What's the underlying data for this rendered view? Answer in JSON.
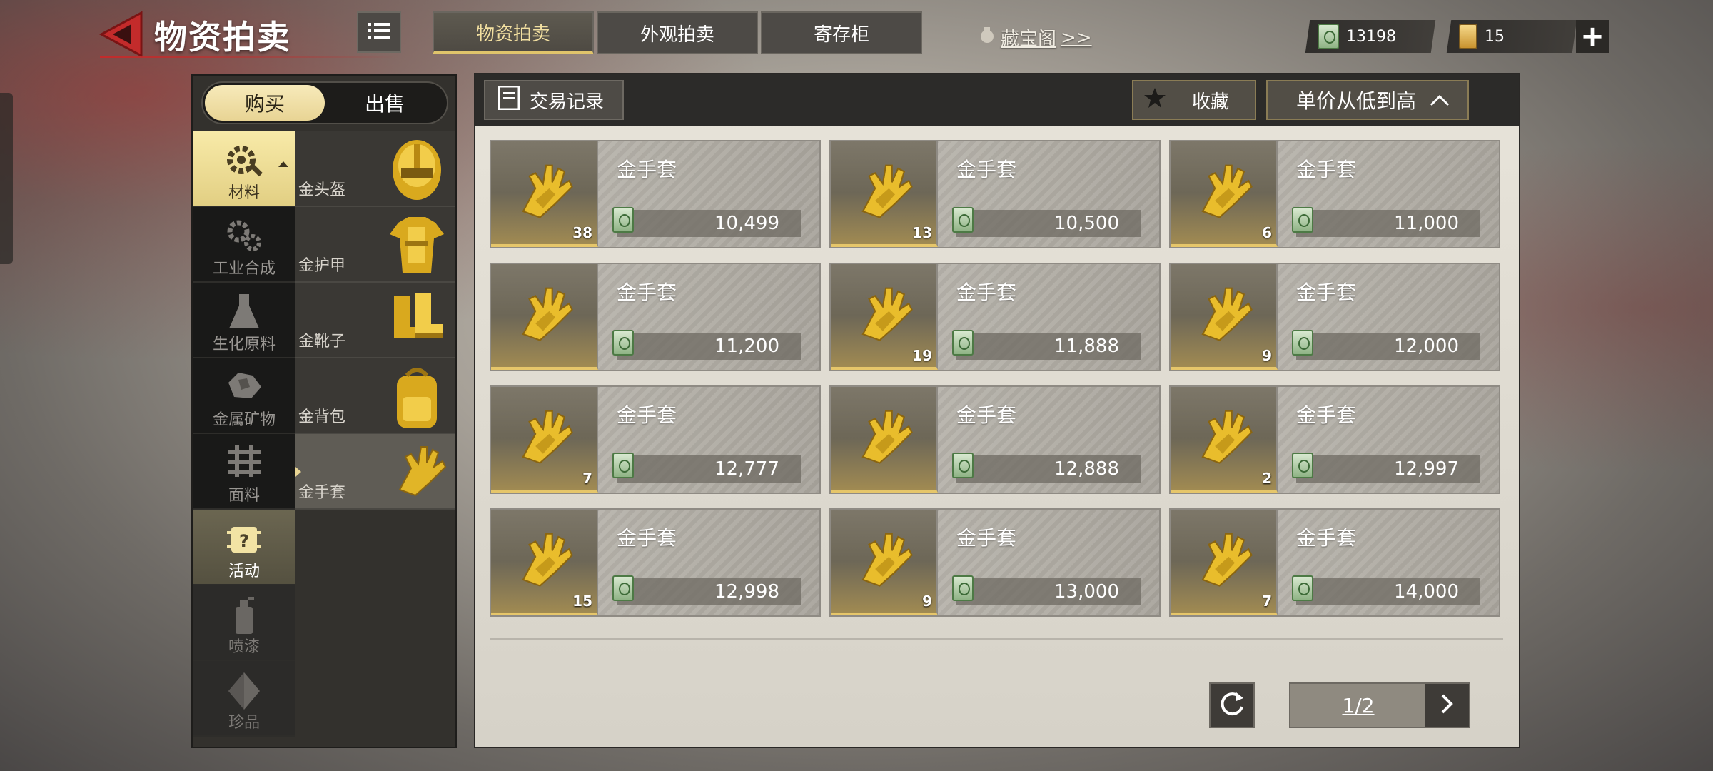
{
  "header": {
    "title": "物资拍卖",
    "tabs": [
      {
        "label": "物资拍卖",
        "active": true
      },
      {
        "label": "外观拍卖",
        "active": false
      },
      {
        "label": "寄存柜",
        "active": false
      }
    ],
    "treasure_link": "藏宝阁",
    "treasure_arrows": ">>",
    "currency_cash": "13198",
    "currency_ticket": "15",
    "plus_label": "+"
  },
  "buy_sell": {
    "buy": "购买",
    "sell": "出售",
    "active": "buy"
  },
  "categories": [
    {
      "label": "材料",
      "icon": "gear-wrench-icon",
      "state": "active"
    },
    {
      "label": "工业合成",
      "icon": "gears-icon",
      "state": "normal"
    },
    {
      "label": "生化原料",
      "icon": "flask-icon",
      "state": "normal"
    },
    {
      "label": "金属矿物",
      "icon": "ore-icon",
      "state": "normal"
    },
    {
      "label": "面料",
      "icon": "fabric-icon",
      "state": "normal"
    },
    {
      "label": "活动",
      "icon": "event-chip-icon",
      "state": "event"
    },
    {
      "label": "喷漆",
      "icon": "spray-can-icon",
      "state": "dim"
    },
    {
      "label": "珍品",
      "icon": "gem-icon",
      "state": "dim"
    }
  ],
  "subcategories": [
    {
      "label": "金头盔",
      "icon": "gold-helmet-icon"
    },
    {
      "label": "金护甲",
      "icon": "gold-armor-icon"
    },
    {
      "label": "金靴子",
      "icon": "gold-boots-icon"
    },
    {
      "label": "金背包",
      "icon": "gold-backpack-icon"
    },
    {
      "label": "金手套",
      "icon": "gold-glove-icon",
      "active": true
    }
  ],
  "toolbar": {
    "trade_record": "交易记录",
    "favorite": "收藏",
    "sort": "单价从低到高"
  },
  "listings": [
    {
      "name": "金手套",
      "price": "10,499",
      "qty": "38"
    },
    {
      "name": "金手套",
      "price": "10,500",
      "qty": "13"
    },
    {
      "name": "金手套",
      "price": "11,000",
      "qty": "6"
    },
    {
      "name": "金手套",
      "price": "11,200",
      "qty": ""
    },
    {
      "name": "金手套",
      "price": "11,888",
      "qty": "19"
    },
    {
      "name": "金手套",
      "price": "12,000",
      "qty": "9"
    },
    {
      "name": "金手套",
      "price": "12,777",
      "qty": "7"
    },
    {
      "name": "金手套",
      "price": "12,888",
      "qty": ""
    },
    {
      "name": "金手套",
      "price": "12,997",
      "qty": "2"
    },
    {
      "name": "金手套",
      "price": "12,998",
      "qty": "15"
    },
    {
      "name": "金手套",
      "price": "13,000",
      "qty": "9"
    },
    {
      "name": "金手套",
      "price": "14,000",
      "qty": "7"
    }
  ],
  "pagination": {
    "page": "1/2"
  },
  "colors": {
    "accent_gold": "#e6c66a",
    "back_red": "#c32b2b"
  }
}
